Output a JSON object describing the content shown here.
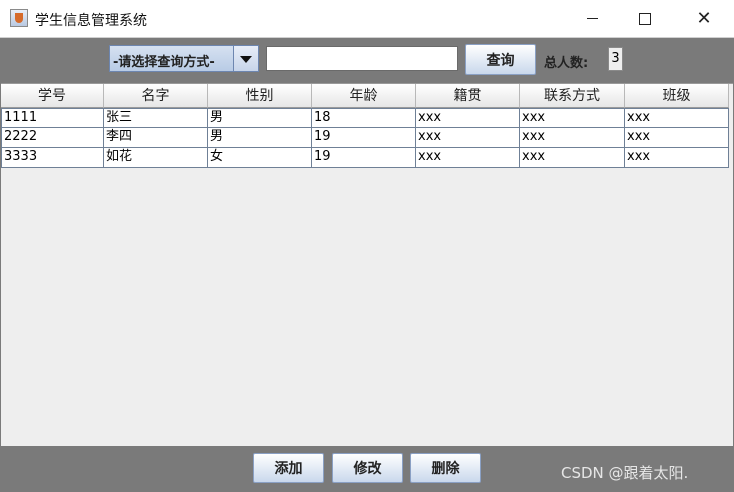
{
  "window": {
    "title": "学生信息管理系统",
    "icon": "java-cup-icon"
  },
  "toolbar": {
    "query_mode_label": "-请选择查询方式-",
    "query_input_value": "",
    "query_button": "查询",
    "total_label": "总人数:",
    "total_value": "3"
  },
  "table": {
    "headers": [
      "学号",
      "名字",
      "性别",
      "年龄",
      "籍贯",
      "联系方式",
      "班级"
    ],
    "rows": [
      [
        "1111",
        "张三",
        "男",
        "18",
        "xxx",
        "xxx",
        "xxx"
      ],
      [
        "2222",
        "李四",
        "男",
        "19",
        "xxx",
        "xxx",
        "xxx"
      ],
      [
        "3333",
        "如花",
        "女",
        "19",
        "xxx",
        "xxx",
        "xxx"
      ]
    ]
  },
  "actions": {
    "add": "添加",
    "edit": "修改",
    "delete": "删除"
  },
  "watermark": "CSDN @跟着太阳."
}
